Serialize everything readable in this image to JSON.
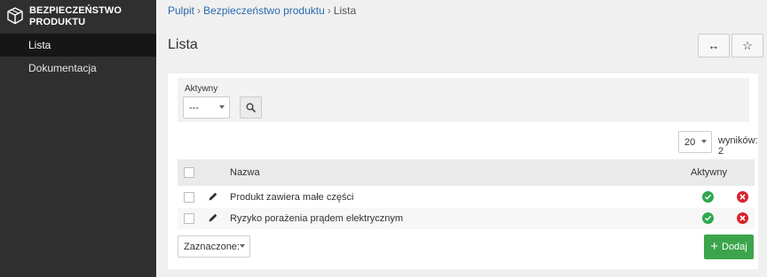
{
  "sidebar": {
    "brand_line1": "BEZPIECZEŃSTWO",
    "brand_line2": "PRODUKTU",
    "items": [
      {
        "label": "Lista",
        "active": true
      },
      {
        "label": "Dokumentacja",
        "active": false
      }
    ]
  },
  "breadcrumb": {
    "home": "Pulpit",
    "section": "Bezpieczeństwo produktu",
    "current": "Lista",
    "separator": "›"
  },
  "page": {
    "title": "Lista",
    "expand_icon": "↔",
    "favorite_icon": "☆"
  },
  "filters": {
    "label": "Aktywny",
    "select_value": "---"
  },
  "pagination": {
    "per_page": "20",
    "results": "wyników: 2"
  },
  "table": {
    "headers": {
      "name": "Nazwa",
      "active": "Aktywny"
    },
    "rows": [
      {
        "name": "Produkt zawiera małe części",
        "active": true
      },
      {
        "name": "Ryzyko porażenia prądem elektrycznym",
        "active": true
      }
    ]
  },
  "actions": {
    "bulk_select": "Zaznaczone:",
    "add_label": "Dodaj",
    "add_icon": "+"
  },
  "colors": {
    "sidebar_bg": "#2f2f2f",
    "sidebar_active": "#161616",
    "link": "#2a6ab1",
    "success": "#2fa84f",
    "danger": "#d9232d",
    "add_button": "#3ca54b"
  }
}
